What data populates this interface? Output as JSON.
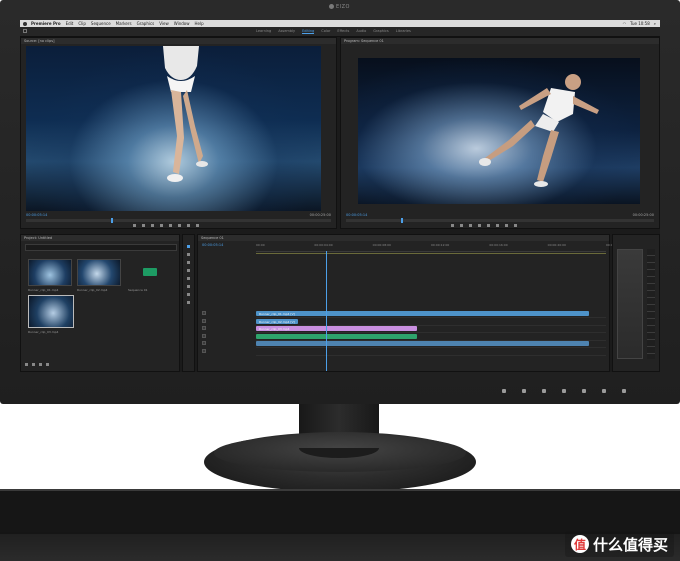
{
  "brand": {
    "logo_text": "EIZO"
  },
  "menubar": {
    "items": [
      "Premiere Pro",
      "Edit",
      "Clip",
      "Sequence",
      "Markers",
      "Graphics",
      "View",
      "Window",
      "Help"
    ],
    "clock": "Tue 10:58"
  },
  "workspaces": {
    "tabs": [
      "Learning",
      "Assembly",
      "Editing",
      "Color",
      "Effects",
      "Audio",
      "Graphics",
      "Libraries"
    ],
    "active_index": 2
  },
  "source_monitor": {
    "title": "Source: [no clips]",
    "timecode_left": "00:00:05:14",
    "timecode_right": "00:00:25:00",
    "playhead_fraction": 0.28
  },
  "program_monitor": {
    "title": "Program: Sequence 01",
    "timecode_left": "00:00:05:14",
    "timecode_right": "00:00:25:00",
    "playhead_fraction": 0.18
  },
  "project_panel": {
    "title": "Project: Untitled",
    "items": [
      {
        "label": "Runner_clip_01.mp4",
        "kind": "video"
      },
      {
        "label": "Runner_clip_02.mp4",
        "kind": "video"
      },
      {
        "label": "Sequence 01",
        "kind": "sequence"
      },
      {
        "label": "Runner_clip_03.mp4",
        "kind": "video"
      }
    ]
  },
  "timeline": {
    "title": "Sequence 01",
    "timecode": "00:00:05:14",
    "ruler": [
      "00:00",
      "00:00:04:00",
      "00:00:08:00",
      "00:00:12:00",
      "00:00:16:00",
      "00:00:20:00",
      "00:00:24:00"
    ],
    "tracks": [
      "V3",
      "V2",
      "V1",
      "A1",
      "A2",
      "A3"
    ],
    "clips": [
      {
        "label": "Runner_clip_01.mp4 [V]",
        "track": 0,
        "start": 0.0,
        "end": 0.95,
        "color": "#4e93c9"
      },
      {
        "label": "Runner_clip_02.mp4 [V]",
        "track": 1,
        "start": 0.0,
        "end": 0.12,
        "color": "#4e93c9"
      },
      {
        "label": "Runner_clip_03.mp4",
        "track": 2,
        "start": 0.0,
        "end": 0.46,
        "color": "#c98fe0"
      },
      {
        "label": "",
        "track": 3,
        "start": 0.0,
        "end": 0.46,
        "color": "#2ea36c"
      },
      {
        "label": "",
        "track": 4,
        "start": 0.0,
        "end": 0.95,
        "color": "#4e83b0"
      }
    ],
    "playhead_fraction": 0.2
  },
  "watermark": {
    "text": "什么值得买",
    "badge": "值"
  }
}
